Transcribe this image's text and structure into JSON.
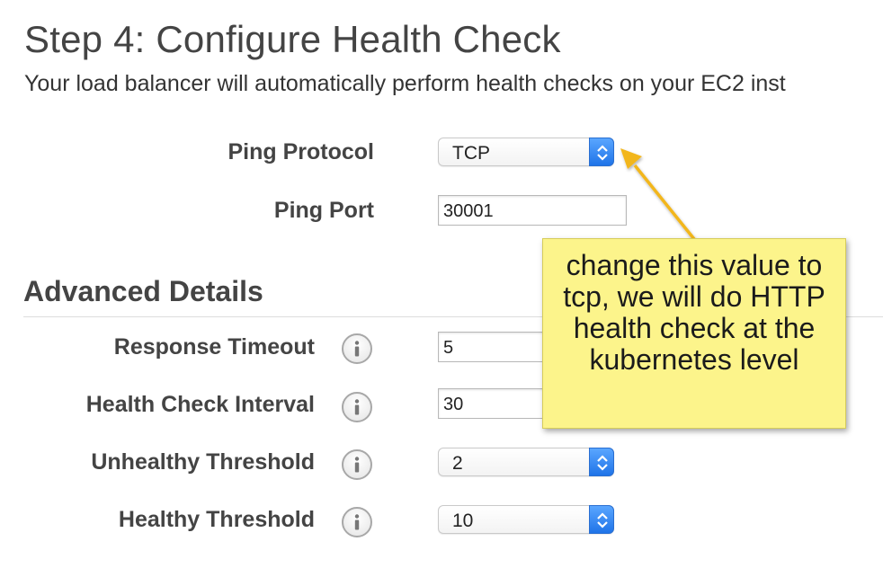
{
  "header": {
    "title": "Step 4: Configure Health Check",
    "description": "Your load balancer will automatically perform health checks on your EC2 inst"
  },
  "ping": {
    "protocol_label": "Ping Protocol",
    "protocol_value": "TCP",
    "port_label": "Ping Port",
    "port_value": "30001"
  },
  "advanced": {
    "section_title": "Advanced Details",
    "response_timeout": {
      "label": "Response Timeout",
      "value": "5"
    },
    "health_check_interval": {
      "label": "Health Check Interval",
      "value": "30"
    },
    "unhealthy_threshold": {
      "label": "Unhealthy Threshold",
      "value": "2"
    },
    "healthy_threshold": {
      "label": "Healthy Threshold",
      "value": "10"
    }
  },
  "annotation": {
    "text": "change this value to tcp, we will do HTTP health check at the kubernetes level",
    "color": "#fcf48b",
    "arrow_color": "#f2b61c"
  },
  "icons": {
    "info": "info-icon",
    "select_toggle": "chevron-up-down-icon"
  }
}
